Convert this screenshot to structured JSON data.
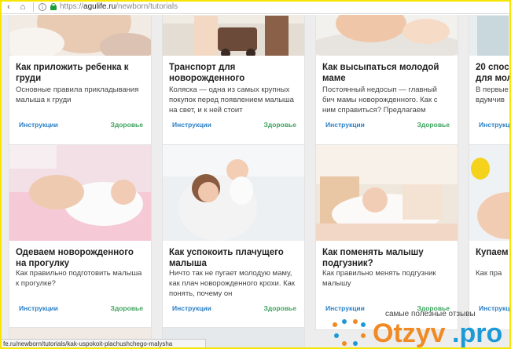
{
  "browser": {
    "url_protocol": "https://",
    "url_host": "agulife.ru",
    "url_path": "/newborn/tutorials"
  },
  "colors": {
    "tag_category": "#2a7fc6",
    "tag_health": "#3da35d",
    "watermark_orange": "#f08a24",
    "watermark_blue": "#1d9ad6"
  },
  "cards": [
    {
      "title": "Как приложить ребенка к груди",
      "desc": "Основные правила прикладывания малыша к груди",
      "category": "Инструкции",
      "tag": "Здоровье"
    },
    {
      "title": "Транспорт для новорожденного",
      "desc": "Коляска — одна из самых крупных покупок перед появлением малыша на свет, и к ней стоит",
      "category": "Инструкции",
      "tag": "Здоровье"
    },
    {
      "title": "Как высыпаться молодой маме",
      "desc": "Постоянный недосып — главный бич мамы новорожденного. Как с ним справиться? Предлагаем",
      "category": "Инструкции",
      "tag": "Здоровье"
    },
    {
      "title": "20 спос для мол",
      "desc": "В первые вдумчив",
      "category": "Инструкц",
      "tag": ""
    },
    {
      "title": "Одеваем новорожденного на прогулку",
      "desc": "Как правильно подготовить малыша к прогулке?",
      "category": "Инструкции",
      "tag": "Здоровье"
    },
    {
      "title": "Как успокоить плачущего малыша",
      "desc": "Ничто так не пугает молодую маму, как плач новорожденного крохи. Как понять, почему он",
      "category": "Инструкции",
      "tag": "Здоровье"
    },
    {
      "title": "Как поменять малышу подгузник?",
      "desc": "Как правильно менять подгузник малышу",
      "category": "Инструкции",
      "tag": "Здоровье"
    },
    {
      "title": "Купаем",
      "desc": "Как пра",
      "category": "Инструкц",
      "tag": ""
    }
  ],
  "status_url": "fe.ru/newborn/tutorials/kak-uspokoit-plachushchego-malysha",
  "watermark": {
    "caption": "самые полезные отзывы",
    "brand": "Otzyv.pro"
  }
}
